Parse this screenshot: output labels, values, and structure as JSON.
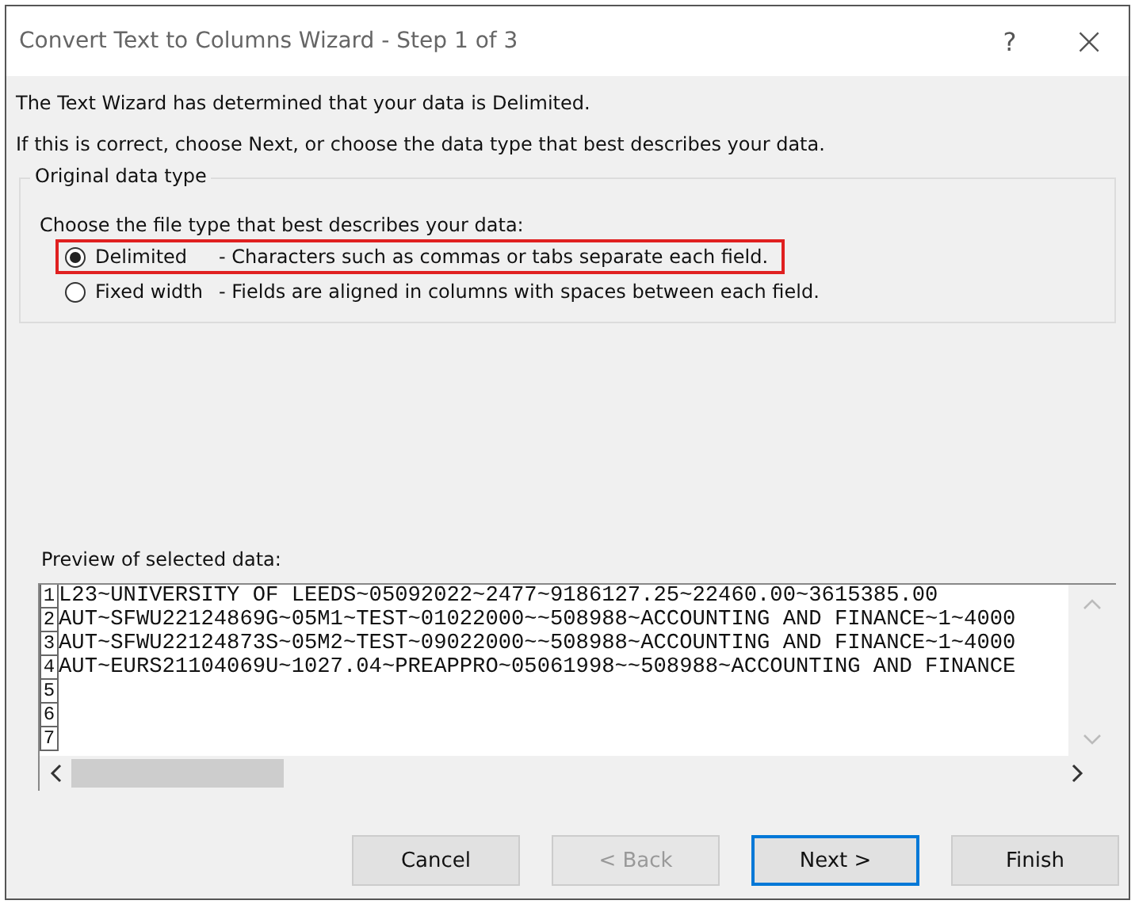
{
  "window": {
    "title": "Convert Text to Columns Wizard - Step 1 of 3",
    "help": "?",
    "close": "×"
  },
  "intro": [
    "The Text Wizard has determined that your data is Delimited.",
    "If this is correct, choose Next, or choose the data type that best describes your data."
  ],
  "group": {
    "title": "Original data type",
    "prompt": "Choose the file type that best describes your data:",
    "options": [
      {
        "label": "Delimited",
        "description": "- Characters such as commas or tabs separate each field.",
        "selected": true,
        "highlighted": true
      },
      {
        "label": "Fixed width",
        "description": "- Fields are aligned in columns with spaces between each field.",
        "selected": false,
        "highlighted": false
      }
    ]
  },
  "preview": {
    "label": "Preview of selected data:",
    "rows": [
      {
        "number": "1",
        "text": "L23~UNIVERSITY OF LEEDS~05092022~2477~9186127.25~22460.00~3615385.00"
      },
      {
        "number": "2",
        "text": "AUT~SFWU22124869G~05M1~TEST~01022000~~508988~ACCOUNTING AND FINANCE~1~4000"
      },
      {
        "number": "3",
        "text": "AUT~SFWU22124873S~05M2~TEST~09022000~~508988~ACCOUNTING AND FINANCE~1~4000"
      },
      {
        "number": "4",
        "text": "AUT~EURS21104069U~1027.04~PREAPPRO~05061998~~508988~ACCOUNTING AND FINANCE"
      },
      {
        "number": "5",
        "text": ""
      },
      {
        "number": "6",
        "text": ""
      },
      {
        "number": "7",
        "text": ""
      }
    ]
  },
  "buttons": [
    {
      "label": "Cancel",
      "disabled": false,
      "default": false
    },
    {
      "label": "< Back",
      "disabled": true,
      "default": false
    },
    {
      "label": "Next >",
      "disabled": false,
      "default": true
    },
    {
      "label": "Finish",
      "disabled": false,
      "default": false
    }
  ]
}
